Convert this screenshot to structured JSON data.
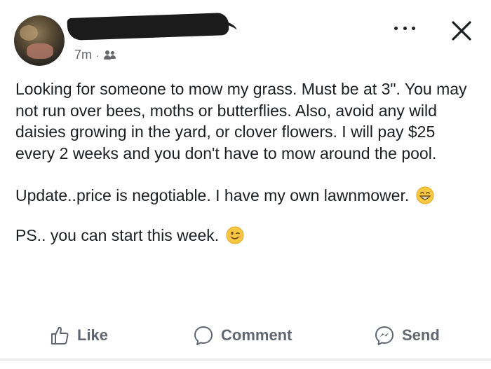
{
  "post": {
    "timestamp": "7m",
    "separator": "·",
    "audience_icon": "friends-icon",
    "paragraphs": [
      "Looking for someone to mow my grass. Must be at 3\". You may not run over bees, moths or butterflies. Also, avoid any wild daisies growing in the yard, or clover flowers. I will pay $25 every 2 weeks and you don't have to mow around the pool.",
      "Update..price is negotiable. I have my own lawnmower.",
      "PS.. you can start this week."
    ],
    "emojis": [
      "grinning-face-emoji",
      "winking-face-emoji"
    ]
  },
  "header": {
    "more_icon": "more-options-icon",
    "close_icon": "close-icon"
  },
  "actions": {
    "like_label": "Like",
    "comment_label": "Comment",
    "send_label": "Send"
  },
  "colors": {
    "text": "#1c1e21",
    "secondary_text": "#65676b",
    "action_text": "#606770",
    "emoji_yellow": "#f7c843"
  }
}
